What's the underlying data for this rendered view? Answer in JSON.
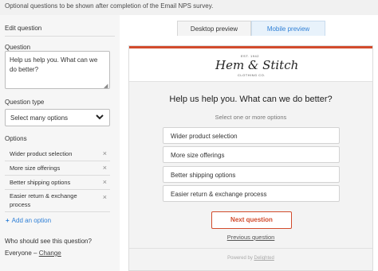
{
  "header": {
    "note": "Optional questions to be shown after completion of the Email NPS survey."
  },
  "sidebar": {
    "title": "Edit question",
    "question_label": "Question",
    "question_text": "Help us help you. What can we do better?",
    "question_type_label": "Question type",
    "question_type_value": "Select many options",
    "options_label": "Options",
    "options": [
      {
        "label": "Wider product selection"
      },
      {
        "label": "More size offerings"
      },
      {
        "label": "Better shipping options"
      },
      {
        "label": "Easier return & exchange process"
      }
    ],
    "remove_icon": "×",
    "add_option_icon": "+",
    "add_option_label": "Add an option",
    "who_label": "Who should see this question?",
    "who_value": "Everyone",
    "who_separator": "–",
    "change_label": "Change"
  },
  "tabs": {
    "desktop": "Desktop preview",
    "mobile": "Mobile preview"
  },
  "preview": {
    "logo": {
      "est": "EST. 1942",
      "name": "Hem & Stitch",
      "sub": "CLOTHING CO."
    },
    "question": "Help us help you. What can we do better?",
    "instruction": "Select one or more options",
    "choices": [
      {
        "label": "Wider product selection"
      },
      {
        "label": "More size offerings"
      },
      {
        "label": "Better shipping options"
      },
      {
        "label": "Easier return & exchange process"
      }
    ],
    "next_label": "Next question",
    "previous_label": "Previous question",
    "powered_prefix": "Powered by",
    "powered_brand": "Delighted"
  },
  "colors": {
    "accent": "#d24b2c",
    "link": "#2e7fd6",
    "sidebar_bg": "#f6f6f6"
  }
}
